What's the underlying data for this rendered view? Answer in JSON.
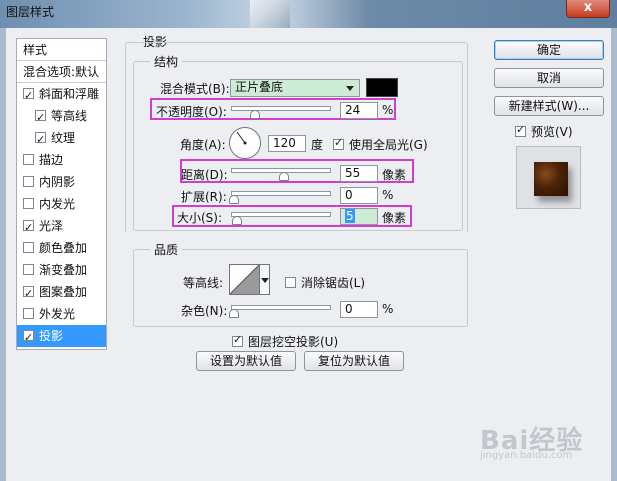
{
  "window": {
    "title": "图层样式",
    "close_label": "x"
  },
  "stylelist": {
    "header": "样式",
    "blend_options": "混合选项:默认",
    "items": [
      {
        "label": "斜面和浮雕",
        "checked": true,
        "indent": false
      },
      {
        "label": "等高线",
        "checked": true,
        "indent": true
      },
      {
        "label": "纹理",
        "checked": true,
        "indent": true
      },
      {
        "label": "描边",
        "checked": false,
        "indent": false
      },
      {
        "label": "内阴影",
        "checked": false,
        "indent": false
      },
      {
        "label": "内发光",
        "checked": false,
        "indent": false
      },
      {
        "label": "光泽",
        "checked": true,
        "indent": false
      },
      {
        "label": "颜色叠加",
        "checked": false,
        "indent": false
      },
      {
        "label": "渐变叠加",
        "checked": false,
        "indent": false
      },
      {
        "label": "图案叠加",
        "checked": true,
        "indent": false
      },
      {
        "label": "外发光",
        "checked": false,
        "indent": false
      },
      {
        "label": "投影",
        "checked": true,
        "indent": false,
        "selected": true
      }
    ]
  },
  "drop_shadow": {
    "section_title": "投影",
    "structure_title": "结构",
    "blend_mode_label": "混合模式(B):",
    "blend_mode_value": "正片叠底",
    "blend_color": "#000000",
    "opacity_label": "不透明度(O):",
    "opacity_value": "24",
    "opacity_unit": "%",
    "opacity_fraction": 0.24,
    "angle_label": "角度(A):",
    "angle_value": "120",
    "angle_unit": "度",
    "global_light_label": "使用全局光(G)",
    "global_light_checked": true,
    "distance_label": "距离(D):",
    "distance_value": "55",
    "distance_unit": "像素",
    "spread_label": "扩展(R):",
    "spread_value": "0",
    "spread_unit": "%",
    "size_label": "大小(S):",
    "size_value": "5",
    "size_unit": "像素",
    "quality_title": "品质",
    "contour_label": "等高线:",
    "antialias_label": "消除锯齿(L)",
    "antialias_checked": false,
    "noise_label": "杂色(N):",
    "noise_value": "0",
    "noise_unit": "%",
    "knockout_label": "图层挖空投影(U)",
    "knockout_checked": true,
    "make_default_label": "设置为默认值",
    "reset_default_label": "复位为默认值"
  },
  "actions": {
    "ok_label": "确定",
    "cancel_label": "取消",
    "new_style_label": "新建样式(W)...",
    "preview_label": "预览(V)",
    "preview_checked": true
  },
  "watermark": {
    "text": "Bai经验",
    "subtext": "jingyan.baidu.com"
  },
  "colors": {
    "highlight": "#d03fcc",
    "selection": "#3399ff",
    "field_highlight": "#cdebd5"
  }
}
